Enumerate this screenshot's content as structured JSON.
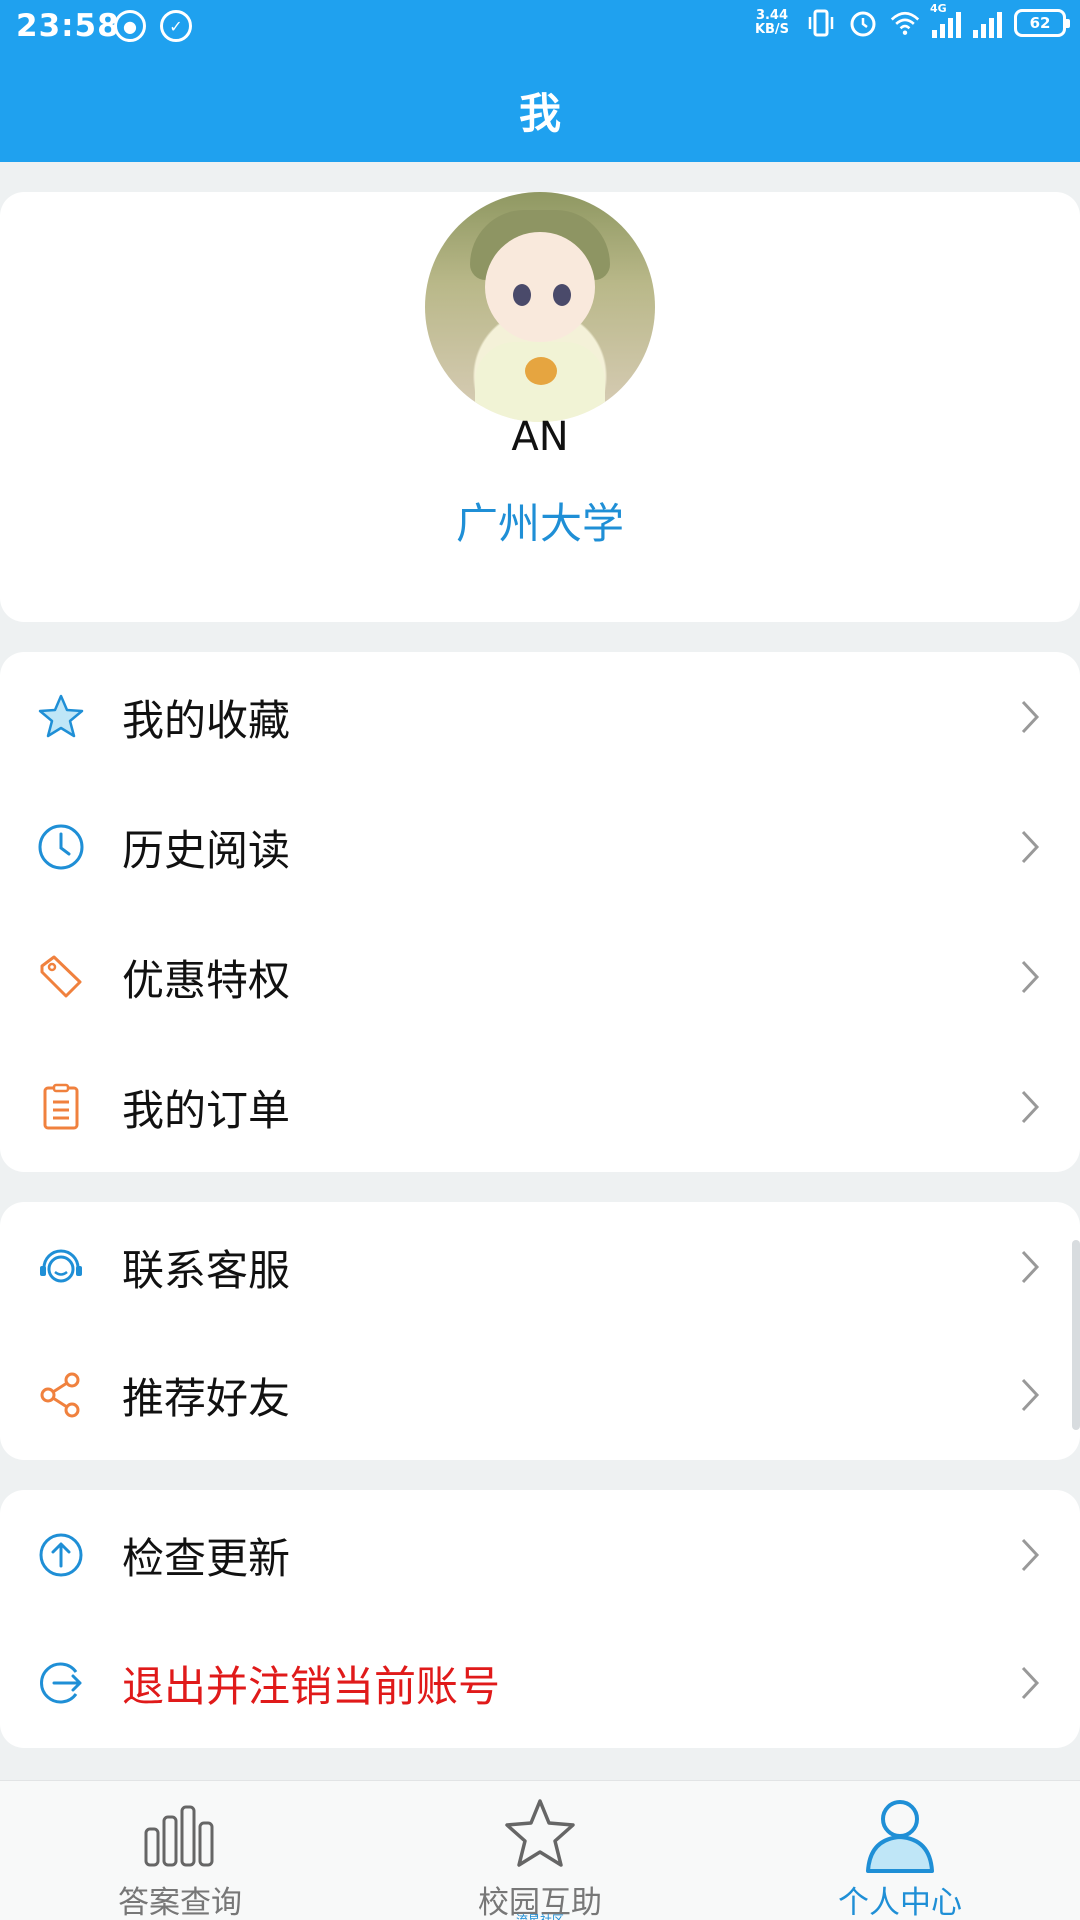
{
  "status_bar": {
    "time": "23:58",
    "speed_top": "3.44",
    "speed_bottom": "KB/S",
    "network_type": "4G",
    "battery": "62",
    "icons": [
      "app-notification-icon",
      "check-circle-icon",
      "vibrate-icon",
      "alarm-icon",
      "wifi-icon",
      "signal-4g-icon",
      "signal-icon",
      "battery-icon"
    ]
  },
  "header": {
    "title": "我"
  },
  "profile": {
    "username": "AN",
    "school": "广州大学"
  },
  "menu_group_1": [
    {
      "label": "我的收藏",
      "icon": "star-icon"
    },
    {
      "label": "历史阅读",
      "icon": "clock-icon"
    },
    {
      "label": "优惠特权",
      "icon": "tag-icon"
    },
    {
      "label": "我的订单",
      "icon": "order-list-icon"
    }
  ],
  "menu_group_2": [
    {
      "label": "联系客服",
      "icon": "headset-icon"
    },
    {
      "label": "推荐好友",
      "icon": "share-icon"
    }
  ],
  "menu_group_3": [
    {
      "label": "检查更新",
      "icon": "upload-arrow-icon"
    },
    {
      "label": "退出并注销当前账号",
      "icon": "logout-icon"
    }
  ],
  "bottom_nav": {
    "items": [
      {
        "label": "答案查询",
        "icon": "bar-chart-icon",
        "active": false
      },
      {
        "label": "校园互助",
        "icon": "star-outline-icon",
        "active": false,
        "sublabel": "流星社区"
      },
      {
        "label": "个人中心",
        "icon": "person-icon",
        "active": true
      }
    ]
  },
  "colors": {
    "primary": "#1fa1ef",
    "accent_blue": "#1f8fd6",
    "danger": "#e01a1a",
    "orange": "#f0813e",
    "background": "#eef1f2"
  }
}
